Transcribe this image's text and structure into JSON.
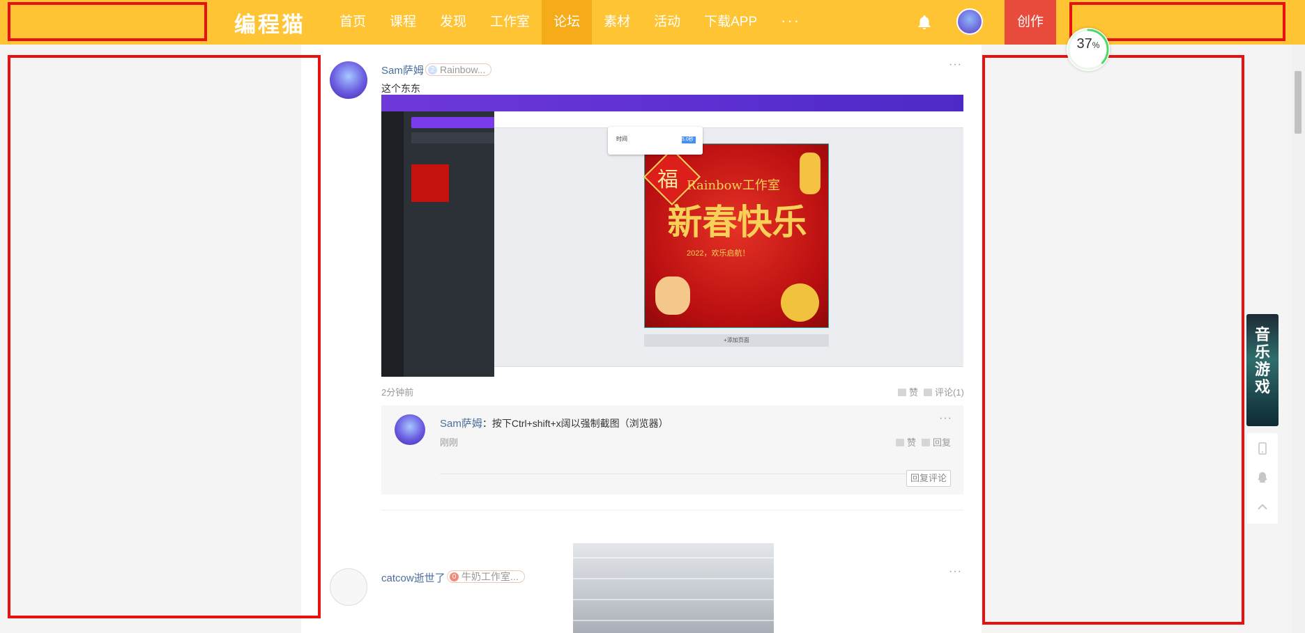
{
  "header": {
    "logo": "编程猫",
    "nav": [
      {
        "label": "首页",
        "active": false
      },
      {
        "label": "课程",
        "active": false
      },
      {
        "label": "发现",
        "active": false
      },
      {
        "label": "工作室",
        "active": false
      },
      {
        "label": "论坛",
        "active": true
      },
      {
        "label": "素材",
        "active": false
      },
      {
        "label": "活动",
        "active": false
      },
      {
        "label": "下载APP",
        "active": false
      }
    ],
    "more": "···",
    "create_label": "创作",
    "bell_icon": "bell-icon",
    "avatar_text": "Sam萨姆"
  },
  "progress": {
    "value": "37",
    "unit": "%"
  },
  "posts": [
    {
      "username": "Sam萨姆",
      "badge_level": "2",
      "badge_text": "Rainbow...",
      "text": "这个东东",
      "time": "2分钟前",
      "like_label": "赞",
      "comment_label": "评论(1)",
      "more": "···",
      "image": {
        "poster_char": "福",
        "poster_sub": "Rainbow工作室",
        "poster_title": "新春快乐",
        "poster_line": "2022，欢乐启航！",
        "add_page": "+添加页面",
        "popup_label": "时间",
        "popup_value": "5.0秒"
      },
      "comments": [
        {
          "username": "Sam萨姆",
          "separator": "：",
          "text": "按下Ctrl+shift+x阔以强制截图（浏览器）",
          "time": "刚刚",
          "like_label": "赞",
          "reply_label": "回复",
          "more": "···"
        }
      ],
      "reply_comment_label": "回复评论"
    },
    {
      "username": "catcow逝世了",
      "badge_level": "0",
      "badge_text": "牛奶工作室...",
      "more": "···"
    }
  ],
  "sidebar_ad": {
    "text": "音乐游戏"
  },
  "colors": {
    "header": "#fec433",
    "nav_active": "#f6ac19",
    "create": "#e84a3c",
    "highlight_box": "#e8110f",
    "link": "#4a6e9b"
  }
}
